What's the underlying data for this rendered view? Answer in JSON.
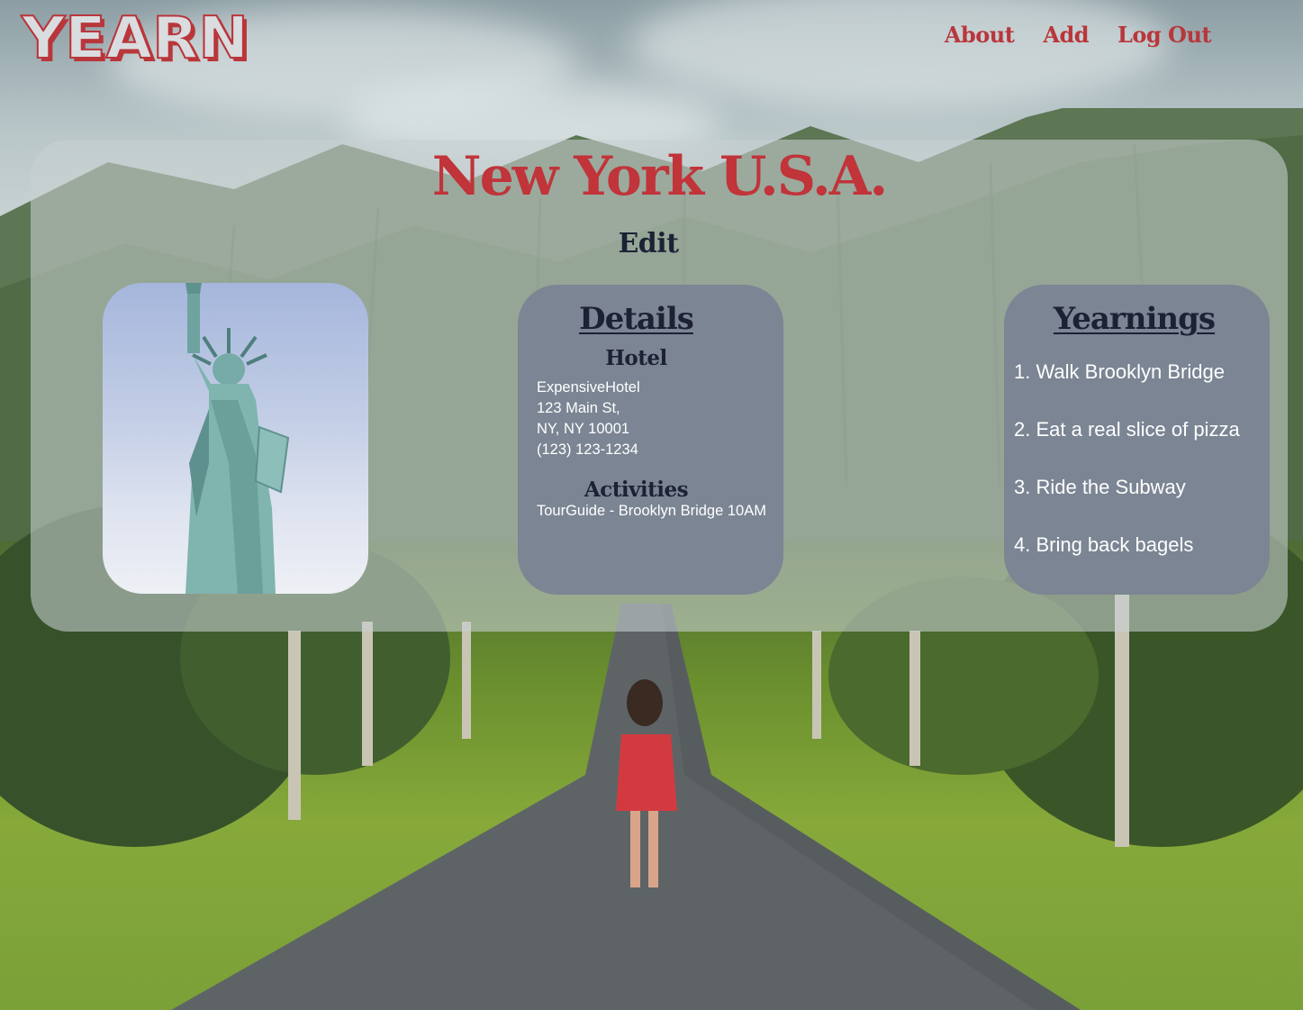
{
  "app": {
    "logo_text": "YEARN"
  },
  "nav": {
    "items": [
      {
        "label": "About"
      },
      {
        "label": "Add"
      },
      {
        "label": "Log Out"
      }
    ]
  },
  "destination": {
    "title": "New York U.S.A.",
    "edit_label": "Edit"
  },
  "details": {
    "heading": "Details",
    "hotel_heading": "Hotel",
    "hotel_lines": [
      "ExpensiveHotel",
      "123 Main St,",
      "NY, NY 10001",
      "(123) 123-1234"
    ],
    "activities_heading": "Activities",
    "activities": [
      "TourGuide - Brooklyn Bridge 10AM"
    ]
  },
  "yearnings": {
    "heading": "Yearnings",
    "items": [
      "1. Walk Brooklyn Bridge",
      "2. Eat a real slice of pizza",
      "3. Ride the Subway",
      "4. Bring back bagels"
    ]
  },
  "colors": {
    "accent_red": "#c0343a",
    "nav_red": "#b9363b",
    "heading_navy": "#1c2134",
    "panel_slate": "#7b8593",
    "card_overlay": "rgba(200,208,210,0.58)"
  },
  "icons": {
    "photo": "statue-of-liberty-image"
  }
}
